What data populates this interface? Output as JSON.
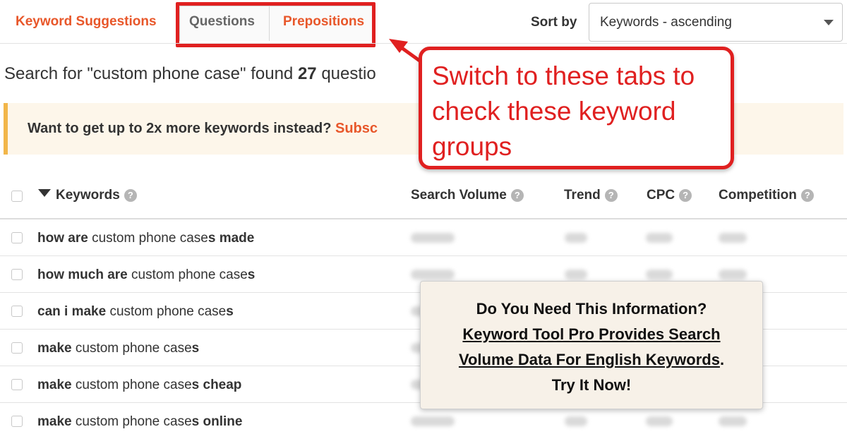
{
  "tabs": {
    "keyword_suggestions": "Keyword Suggestions",
    "questions": "Questions",
    "prepositions": "Prepositions"
  },
  "sort": {
    "label": "Sort by",
    "value": "Keywords - ascending"
  },
  "results": {
    "prefix": "Search for \"custom phone case\" found ",
    "count": "27",
    "suffix": " questio"
  },
  "upsell": {
    "text": "Want to get up to 2x more keywords instead? ",
    "link": "Subsc"
  },
  "callout": {
    "text": "Switch to these tabs to check these keyword groups"
  },
  "table": {
    "headers": {
      "keywords": "Keywords",
      "search_volume": "Search Volume",
      "trend": "Trend",
      "cpc": "CPC",
      "competition": "Competition"
    },
    "help_icon": "?",
    "rows": [
      {
        "parts": [
          {
            "text": "how are",
            "bold": true
          },
          {
            "text": " custom phone case",
            "bold": false
          },
          {
            "text": "s made",
            "bold": true
          }
        ]
      },
      {
        "parts": [
          {
            "text": "how much are",
            "bold": true
          },
          {
            "text": " custom phone case",
            "bold": false
          },
          {
            "text": "s",
            "bold": true
          }
        ]
      },
      {
        "parts": [
          {
            "text": "can i make",
            "bold": true
          },
          {
            "text": " custom phone case",
            "bold": false
          },
          {
            "text": "s",
            "bold": true
          }
        ]
      },
      {
        "parts": [
          {
            "text": "make",
            "bold": true
          },
          {
            "text": " custom phone case",
            "bold": false
          },
          {
            "text": "s",
            "bold": true
          }
        ]
      },
      {
        "parts": [
          {
            "text": "make",
            "bold": true
          },
          {
            "text": " custom phone case",
            "bold": false
          },
          {
            "text": "s cheap",
            "bold": true
          }
        ]
      },
      {
        "parts": [
          {
            "text": "make",
            "bold": true
          },
          {
            "text": " custom phone case",
            "bold": false
          },
          {
            "text": "s online",
            "bold": true
          }
        ]
      }
    ]
  },
  "pro_overlay": {
    "line1": "Do You Need This Information?",
    "line2": "Keyword Tool Pro Provides Search",
    "line3_link": "Volume Data For English Keywords",
    "line3_end": ".",
    "line4": "Try It Now!"
  },
  "colors": {
    "accent": "#e8572a",
    "callout_red": "#e02020",
    "banner_bg": "#fdf6ea",
    "banner_border": "#f2b64a",
    "overlay_bg": "#f7f1e8"
  }
}
